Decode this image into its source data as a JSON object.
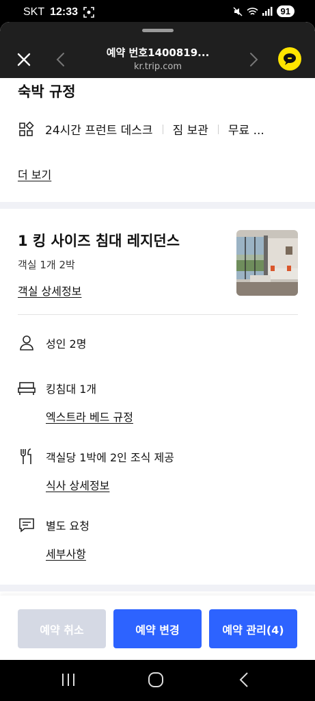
{
  "status": {
    "carrier": "SKT",
    "time": "12:33",
    "battery": "91"
  },
  "header": {
    "title": "예약 번호1400819...",
    "subtitle": "kr.trip.com"
  },
  "policy": {
    "heading": "숙박 규정",
    "amenities": [
      "24시간 프런트 데스크",
      "짐 보관",
      "무료 ..."
    ],
    "more_link": "더 보기"
  },
  "room": {
    "title": "1 킹 사이즈 침대 레지던스",
    "summary": "객실 1개 2박",
    "detail_link": "객실 상세정보",
    "guests": "성인 2명",
    "bed": "킹침대 1개",
    "bed_link": "엑스트라 베드 규정",
    "meal": "객실당 1박에 2인 조식 제공",
    "meal_link": "식사 상세정보",
    "request": "별도 요청",
    "request_link": "세부사항"
  },
  "actions": {
    "cancel": "예약 취소",
    "change": "예약 변경",
    "manage": "예약 관리(4)"
  },
  "colors": {
    "primary": "#2d63ff",
    "disabled": "#d5d9e4",
    "chat": "#ffe400"
  }
}
